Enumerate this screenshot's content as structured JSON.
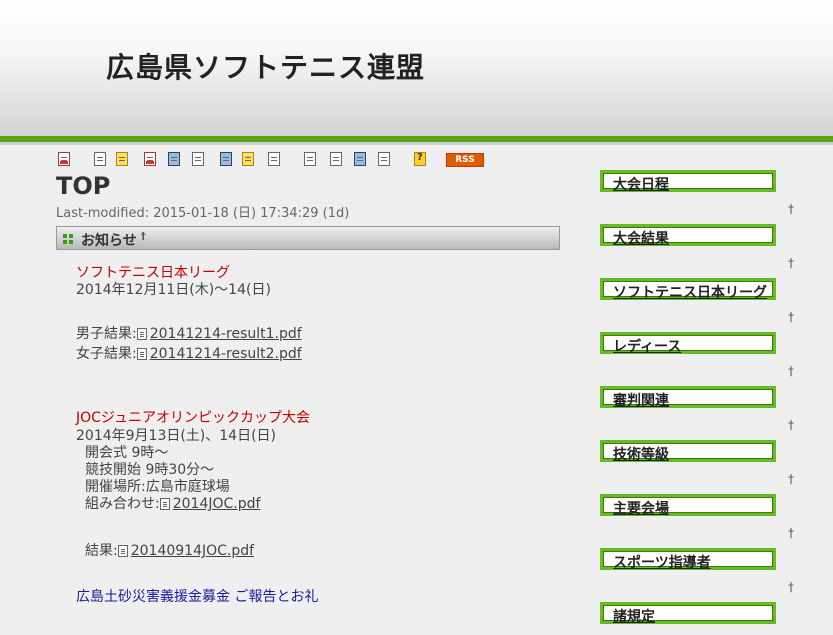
{
  "header": {
    "site_title": "広島県ソフトテニス連盟"
  },
  "toolbar": {
    "rss_label": "RSS",
    "help_label": "?"
  },
  "page": {
    "title": "TOP",
    "last_modified": "Last-modified: 2015-01-18 (日) 17:34:29 (1d)"
  },
  "section": {
    "title": "お知らせ",
    "anchor": "†"
  },
  "news": {
    "league_link": "ソフトテニス日本リーグ",
    "league_date": "2014年12月11日(木)～14(日)",
    "men_label": "男子結果:",
    "men_file": "20141214-result1.pdf",
    "women_label": "女子結果:",
    "women_file": "20141214-result2.pdf",
    "joc_link": "JOCジュニアオリンピックカップ大会",
    "joc_date": "2014年9月13日(土)、14日(日)",
    "joc_open": "開会式  9時～",
    "joc_start": "競技開始  9時30分～",
    "joc_venue": "開催場所:広島市庭球場",
    "joc_combo_label": "組み合わせ:",
    "joc_combo_file": "2014JOC.pdf",
    "joc_result_label": "結果:",
    "joc_result_file": "20140914JOC.pdf",
    "donation_link": "広島土砂災害義援金募金  ご報告とお礼"
  },
  "sidebar": {
    "up_mark": "†",
    "items": [
      {
        "label": "大会日程"
      },
      {
        "label": "大会結果"
      },
      {
        "label": "ソフトテニス日本リーグ"
      },
      {
        "label": "レディース"
      },
      {
        "label": "審判関連"
      },
      {
        "label": "技術等級"
      },
      {
        "label": "主要会場"
      },
      {
        "label": "スポーツ指導者"
      },
      {
        "label": "諸規定"
      }
    ]
  },
  "colors": {
    "accent_green": "#5ea11a",
    "link_red": "#c00000",
    "link_blue": "#1a1aa0",
    "rss_orange": "#e35b00"
  }
}
